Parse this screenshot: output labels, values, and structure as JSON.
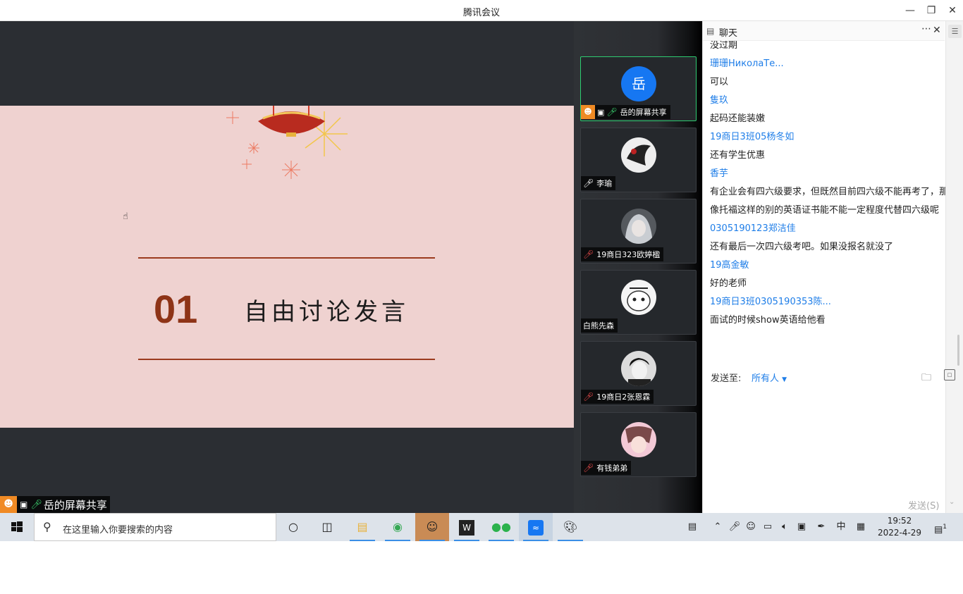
{
  "window": {
    "title": "腾讯会议"
  },
  "slide": {
    "number": "01",
    "heading": "自由讨论发言"
  },
  "share_label": "岳的屏幕共享",
  "participants": [
    {
      "name": "岳的屏幕共享",
      "avatar_text": "岳"
    },
    {
      "name": "李瑜"
    },
    {
      "name": "19商日323欧婷楹"
    },
    {
      "name": "白熊先森"
    },
    {
      "name": "19商日2张恩霖"
    },
    {
      "name": "有钱弟弟"
    }
  ],
  "chat": {
    "title": "聊天",
    "messages": [
      {
        "text": "没过期",
        "kind": "text"
      },
      {
        "text": "珊珊НиколаТе...",
        "kind": "sender"
      },
      {
        "text": "可以",
        "kind": "text"
      },
      {
        "text": "隻玖",
        "kind": "sender"
      },
      {
        "text": "起码还能装嫩",
        "kind": "text"
      },
      {
        "text": "19商日3班05杨冬如",
        "kind": "sender"
      },
      {
        "text": "还有学生优惠",
        "kind": "text"
      },
      {
        "text": "香芋",
        "kind": "sender"
      },
      {
        "text": "有企业会有四六级要求，但既然目前四六级不能再考了，那么像托福这样的别的英语证书能不能一定程度代替四六级呢",
        "kind": "text"
      },
      {
        "text": "0305190123郑洁佳",
        "kind": "sender"
      },
      {
        "text": "还有最后一次四六级考吧。如果没报名就没了",
        "kind": "text"
      },
      {
        "text": "19高金敏",
        "kind": "sender"
      },
      {
        "text": "好的老师",
        "kind": "text"
      },
      {
        "text": "19商日3班0305190353陈...",
        "kind": "sender"
      },
      {
        "text": "面试的时候show英语给他看",
        "kind": "text"
      }
    ],
    "send_to_label": "发送至:",
    "send_to_value": "所有人",
    "send_button": "发送(S)"
  },
  "taskbar": {
    "search_placeholder": "在这里输入你要搜索的内容",
    "ime": "中",
    "time": "19:52",
    "date": "2022-4-29",
    "notification_count": "1"
  },
  "colors": {
    "accent": "#1f7ee8",
    "active_border": "#2ecc71",
    "share_icon": "#f08a24",
    "slide_bg": "#efd2d0",
    "slide_text": "#8e3417"
  }
}
